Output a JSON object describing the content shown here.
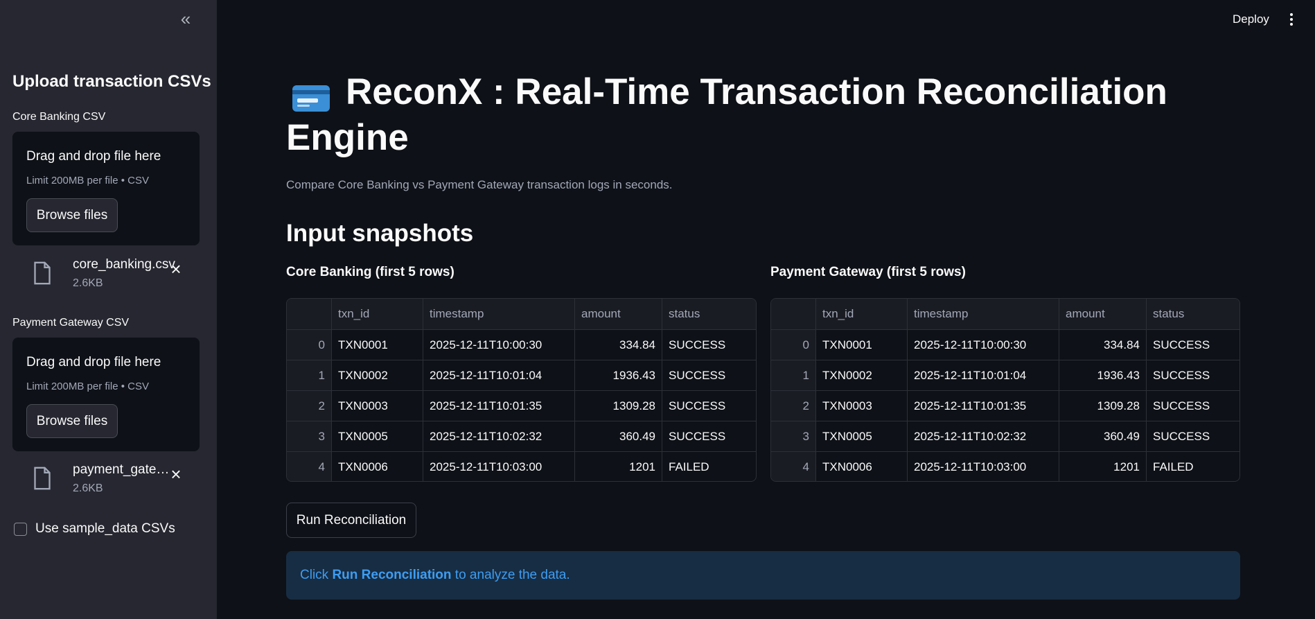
{
  "sidebar": {
    "collapse_icon": "«",
    "title": "Upload transaction CSVs",
    "core_uploader": {
      "label": "Core Banking CSV",
      "drop_text": "Drag and drop file here",
      "limit_text": "Limit 200MB per file • CSV",
      "browse_label": "Browse files",
      "file_name": "core_banking.csv",
      "file_size": "2.6KB"
    },
    "gateway_uploader": {
      "label": "Payment Gateway CSV",
      "drop_text": "Drag and drop file here",
      "limit_text": "Limit 200MB per file • CSV",
      "browse_label": "Browse files",
      "file_name": "payment_gateway.csv",
      "file_size": "2.6KB"
    },
    "sample_checkbox": {
      "label": "Use sample_data CSVs",
      "checked": false
    }
  },
  "header": {
    "deploy_label": "Deploy"
  },
  "main": {
    "title": "ReconX : Real-Time Transaction Reconciliation Engine",
    "title_icon": "credit-card-icon",
    "subtitle": "Compare Core Banking vs Payment Gateway transaction logs in seconds.",
    "section_heading": "Input snapshots",
    "core_table_heading": "Core Banking (first 5 rows)",
    "gateway_table_heading": "Payment Gateway (first 5 rows)",
    "columns": [
      "",
      "txn_id",
      "timestamp",
      "amount",
      "status"
    ],
    "core_rows": [
      [
        "0",
        "TXN0001",
        "2025-12-11T10:00:30",
        "334.84",
        "SUCCESS"
      ],
      [
        "1",
        "TXN0002",
        "2025-12-11T10:01:04",
        "1936.43",
        "SUCCESS"
      ],
      [
        "2",
        "TXN0003",
        "2025-12-11T10:01:35",
        "1309.28",
        "SUCCESS"
      ],
      [
        "3",
        "TXN0005",
        "2025-12-11T10:02:32",
        "360.49",
        "SUCCESS"
      ],
      [
        "4",
        "TXN0006",
        "2025-12-11T10:03:00",
        "1201",
        "FAILED"
      ]
    ],
    "gateway_rows": [
      [
        "0",
        "TXN0001",
        "2025-12-11T10:00:30",
        "334.84",
        "SUCCESS"
      ],
      [
        "1",
        "TXN0002",
        "2025-12-11T10:01:04",
        "1936.43",
        "SUCCESS"
      ],
      [
        "2",
        "TXN0003",
        "2025-12-11T10:01:35",
        "1309.28",
        "SUCCESS"
      ],
      [
        "3",
        "TXN0005",
        "2025-12-11T10:02:32",
        "360.49",
        "SUCCESS"
      ],
      [
        "4",
        "TXN0006",
        "2025-12-11T10:03:00",
        "1201",
        "FAILED"
      ]
    ],
    "run_button_label": "Run Reconciliation",
    "info": {
      "prefix": "Click ",
      "emphasis": "Run Reconciliation",
      "suffix": " to analyze the data."
    }
  },
  "colors": {
    "background": "#0e1117",
    "sidebar": "#262730",
    "info_background": "#172d43",
    "info_text": "#3d9df3"
  }
}
